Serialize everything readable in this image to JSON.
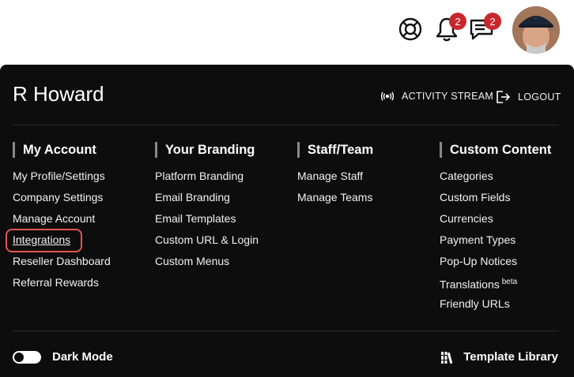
{
  "topbar": {
    "help_icon": "lifebuoy-icon",
    "notifications": {
      "icon": "bell-icon",
      "count": "2"
    },
    "messages": {
      "icon": "message-icon",
      "count": "2"
    },
    "avatar": "user-avatar"
  },
  "header": {
    "user_name": "R Howard",
    "activity_stream_label": "ACTIVITY STREAM",
    "logout_label": "LOGOUT"
  },
  "columns": [
    {
      "title": "My Account",
      "items": [
        "My Profile/Settings",
        "Company Settings",
        "Manage Account",
        "Integrations",
        "Reseller Dashboard",
        "Referral Rewards"
      ]
    },
    {
      "title": "Your Branding",
      "items": [
        "Platform Branding",
        "Email Branding",
        "Email Templates",
        "Custom URL & Login",
        "Custom Menus"
      ]
    },
    {
      "title": "Staff/Team",
      "items": [
        "Manage Staff",
        "Manage Teams"
      ]
    },
    {
      "title": "Custom Content",
      "items": [
        "Categories",
        "Custom Fields",
        "Currencies",
        "Payment Types",
        "Pop-Up Notices",
        "Translations",
        "Friendly URLs"
      ],
      "translations_sup": "beta"
    }
  ],
  "footer": {
    "dark_mode_label": "Dark Mode",
    "template_library_label": "Template Library"
  },
  "colors": {
    "panel_bg": "#0d0d0e",
    "badge": "#c8282d",
    "highlight": "#e2574c"
  }
}
